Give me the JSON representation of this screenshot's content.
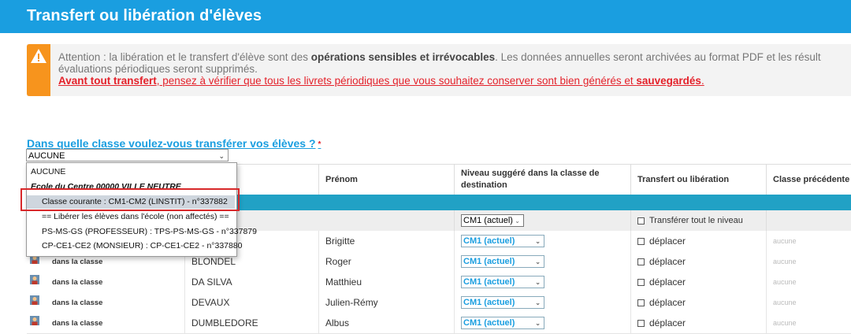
{
  "header": {
    "title": "Transfert ou libération d'élèves"
  },
  "alert": {
    "line1_prefix": "Attention : la libération et le transfert d'élève sont des ",
    "line1_bold": "opérations sensibles et irrévocables",
    "line1_suffix": ". Les données annuelles seront archivées au format PDF et les résult",
    "line2": "évaluations périodiques seront supprimés.",
    "line3_bold": "Avant tout transfert",
    "line3_mid": ", pensez à vérifier que tous les livrets périodiques que vous souhaitez conserver sont bien générés et ",
    "line3_bold2": "sauvegardés",
    "line3_end": "."
  },
  "question": {
    "label": "Dans quelle classe voulez-vous transférer vos élèves ?",
    "required": "*"
  },
  "class_select": {
    "value": "AUCUNE",
    "options": [
      {
        "label": "AUCUNE",
        "group": false,
        "indented": false,
        "selected": false
      },
      {
        "label": "Ecole du Centre 00000 VILLE NEUTRE",
        "group": true,
        "indented": false,
        "selected": false
      },
      {
        "label": "Classe courante : CM1-CM2 (LINSTIT) - n°337882",
        "group": false,
        "indented": true,
        "selected": true
      },
      {
        "label": "== Libérer les élèves dans l'école (non affectés) ==",
        "group": false,
        "indented": true,
        "selected": false
      },
      {
        "label": "PS-MS-GS (PROFESSEUR) : TPS-PS-MS-GS - n°337879",
        "group": false,
        "indented": true,
        "selected": false
      },
      {
        "label": "CP-CE1-CE2 (MONSIEUR) : CP-CE1-CE2 - n°337880",
        "group": false,
        "indented": true,
        "selected": false
      }
    ]
  },
  "table": {
    "headers": {
      "prenom": "Prénom",
      "niveau": "Niveau suggéré dans la classe de destination",
      "transfert": "Transfert ou libération",
      "classe": "Classe précédente"
    },
    "filter": {
      "niveau": "CM1 (actuel)",
      "transfer_all": "Transférer tout le niveau"
    },
    "rows": [
      {
        "status": "",
        "nom": "",
        "prenom": "Brigitte",
        "niveau": "CM1 (actuel)",
        "action": "déplacer",
        "classe": "aucune"
      },
      {
        "status": "dans la classe",
        "nom": "BLONDEL",
        "prenom": "Roger",
        "niveau": "CM1 (actuel)",
        "action": "déplacer",
        "classe": "aucune"
      },
      {
        "status": "dans la classe",
        "nom": "DA SILVA",
        "prenom": "Matthieu",
        "niveau": "CM1 (actuel)",
        "action": "déplacer",
        "classe": "aucune"
      },
      {
        "status": "dans la classe",
        "nom": "DEVAUX",
        "prenom": "Julien-Rémy",
        "niveau": "CM1 (actuel)",
        "action": "déplacer",
        "classe": "aucune"
      },
      {
        "status": "dans la classe",
        "nom": "DUMBLEDORE",
        "prenom": "Albus",
        "niveau": "CM1 (actuel)",
        "action": "déplacer",
        "classe": "aucune"
      }
    ]
  },
  "colors": {
    "header_blue": "#1a9ee0",
    "alert_orange": "#f7941d",
    "danger_red": "#e4212a",
    "table_band": "#21a1c5"
  }
}
